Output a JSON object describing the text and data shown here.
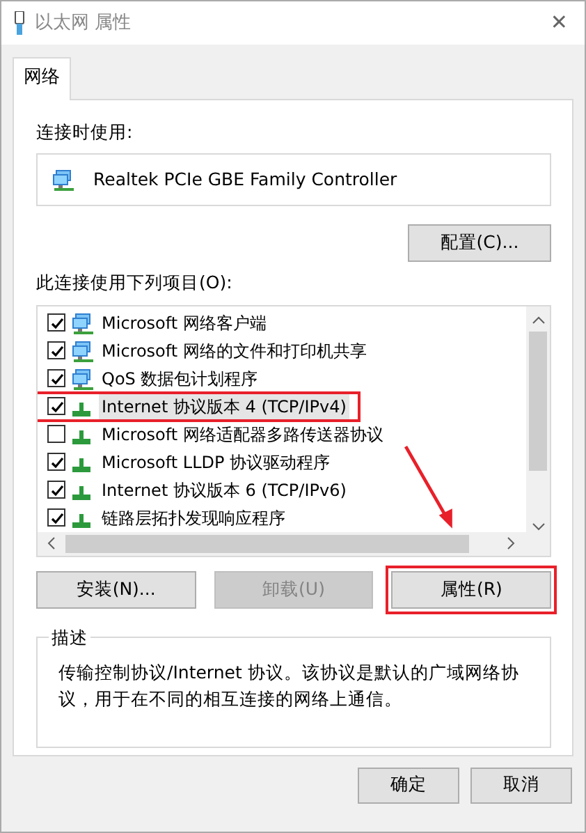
{
  "window": {
    "title": "以太网 属性",
    "close": "✕"
  },
  "tabs": [
    {
      "label": "网络",
      "selected": true
    }
  ],
  "connect_using": {
    "label": "连接时使用:",
    "adapter": "Realtek PCIe GBE Family Controller",
    "configure_button": "配置(C)..."
  },
  "items_label": "此连接使用下列项目(O):",
  "items": [
    {
      "label": "Microsoft 网络客户端",
      "checked": true,
      "selected": false,
      "kind": "client",
      "highlighted": false
    },
    {
      "label": "Microsoft 网络的文件和打印机共享",
      "checked": true,
      "selected": false,
      "kind": "service",
      "highlighted": false
    },
    {
      "label": "QoS 数据包计划程序",
      "checked": true,
      "selected": false,
      "kind": "service",
      "highlighted": false
    },
    {
      "label": "Internet 协议版本 4 (TCP/IPv4)",
      "checked": true,
      "selected": true,
      "kind": "protocol",
      "highlighted": true
    },
    {
      "label": "Microsoft 网络适配器多路传送器协议",
      "checked": false,
      "selected": false,
      "kind": "protocol",
      "highlighted": false
    },
    {
      "label": "Microsoft LLDP 协议驱动程序",
      "checked": true,
      "selected": false,
      "kind": "protocol",
      "highlighted": false
    },
    {
      "label": "Internet 协议版本 6 (TCP/IPv6)",
      "checked": true,
      "selected": false,
      "kind": "protocol",
      "highlighted": false
    },
    {
      "label": "链路层拓扑发现响应程序",
      "checked": true,
      "selected": false,
      "kind": "protocol",
      "highlighted": false
    }
  ],
  "item_buttons": [
    {
      "label": "安装(N)...",
      "disabled": false,
      "highlighted": false
    },
    {
      "label": "卸载(U)",
      "disabled": true,
      "highlighted": false
    },
    {
      "label": "属性(R)",
      "disabled": false,
      "highlighted": true
    }
  ],
  "description": {
    "legend": "描述",
    "text": "传输控制协议/Internet 协议。该协议是默认的广域网络协议，用于在不同的相互连接的网络上通信。"
  },
  "footer_buttons": [
    {
      "label": "确定"
    },
    {
      "label": "取消"
    }
  ]
}
